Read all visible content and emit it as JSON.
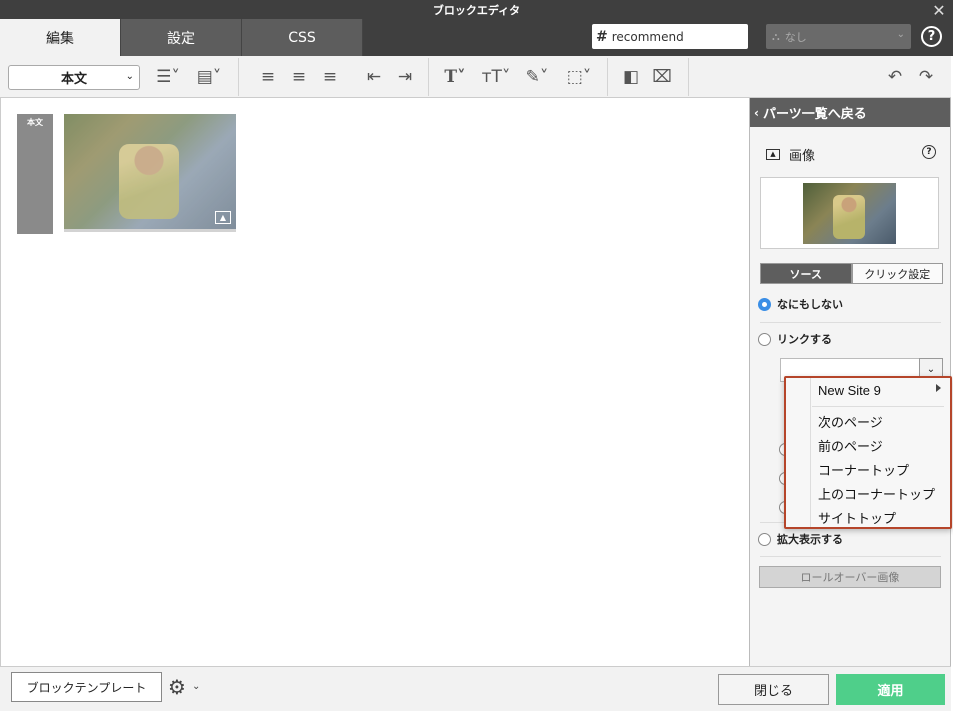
{
  "window": {
    "title": "ブロックエディタ"
  },
  "tabs": [
    {
      "label": "編集"
    },
    {
      "label": "設定"
    },
    {
      "label": "CSS"
    }
  ],
  "header": {
    "css_value": "recommend",
    "class_select_value": "なし"
  },
  "toolbar": {
    "style_select_value": "本文"
  },
  "canvas": {
    "block_label": "本文"
  },
  "panel": {
    "back_label": "パーツ一覧へ戻る",
    "title": "画像",
    "subtabs": [
      {
        "label": "ソース"
      },
      {
        "label": "クリック設定"
      }
    ],
    "options": {
      "none": "なにもしない",
      "link": "リンクする",
      "zoom": "拡大表示する"
    },
    "rollover_button": "ロールオーバー画像"
  },
  "dropdown": {
    "items": [
      "New Site 9",
      "次のページ",
      "前のページ",
      "コーナートップ",
      "上のコーナートップ",
      "サイトトップ"
    ]
  },
  "footer": {
    "template_button": "ブロックテンプレート",
    "close_button": "閉じる",
    "apply_button": "適用"
  },
  "colors": {
    "accent": "#3a8ee6",
    "apply": "#4fcf8a",
    "highlight_border": "#b5452a"
  }
}
